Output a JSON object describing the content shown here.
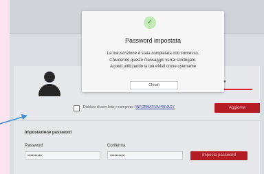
{
  "modal": {
    "title": "Password impostata",
    "lines": [
      "La tua iscrizione è stata completata con successo.",
      "Chiudendo questo messaggio verrai scollegato.",
      "Accedi utilizzando la tua eMail come username"
    ],
    "close_label": "Chiudi",
    "icon": "check-icon"
  },
  "profile": {
    "field_label_partial": "are",
    "privacy_text": "Dichiaro di aver letto e compreso l'",
    "privacy_link": "INFORMATIVA PRIVACY",
    "update_label": "Aggiorna"
  },
  "password_section": {
    "title": "Impostazione password",
    "password_label": "Password",
    "password_value": "••••••••••",
    "confirm_label": "Conferma",
    "confirm_value": "••••••••••",
    "submit_label": "Imposta password"
  },
  "colors": {
    "accent_red": "#b41c25",
    "success_green": "#2d8f2d",
    "annotation_arrow": "#3a8fd8"
  }
}
